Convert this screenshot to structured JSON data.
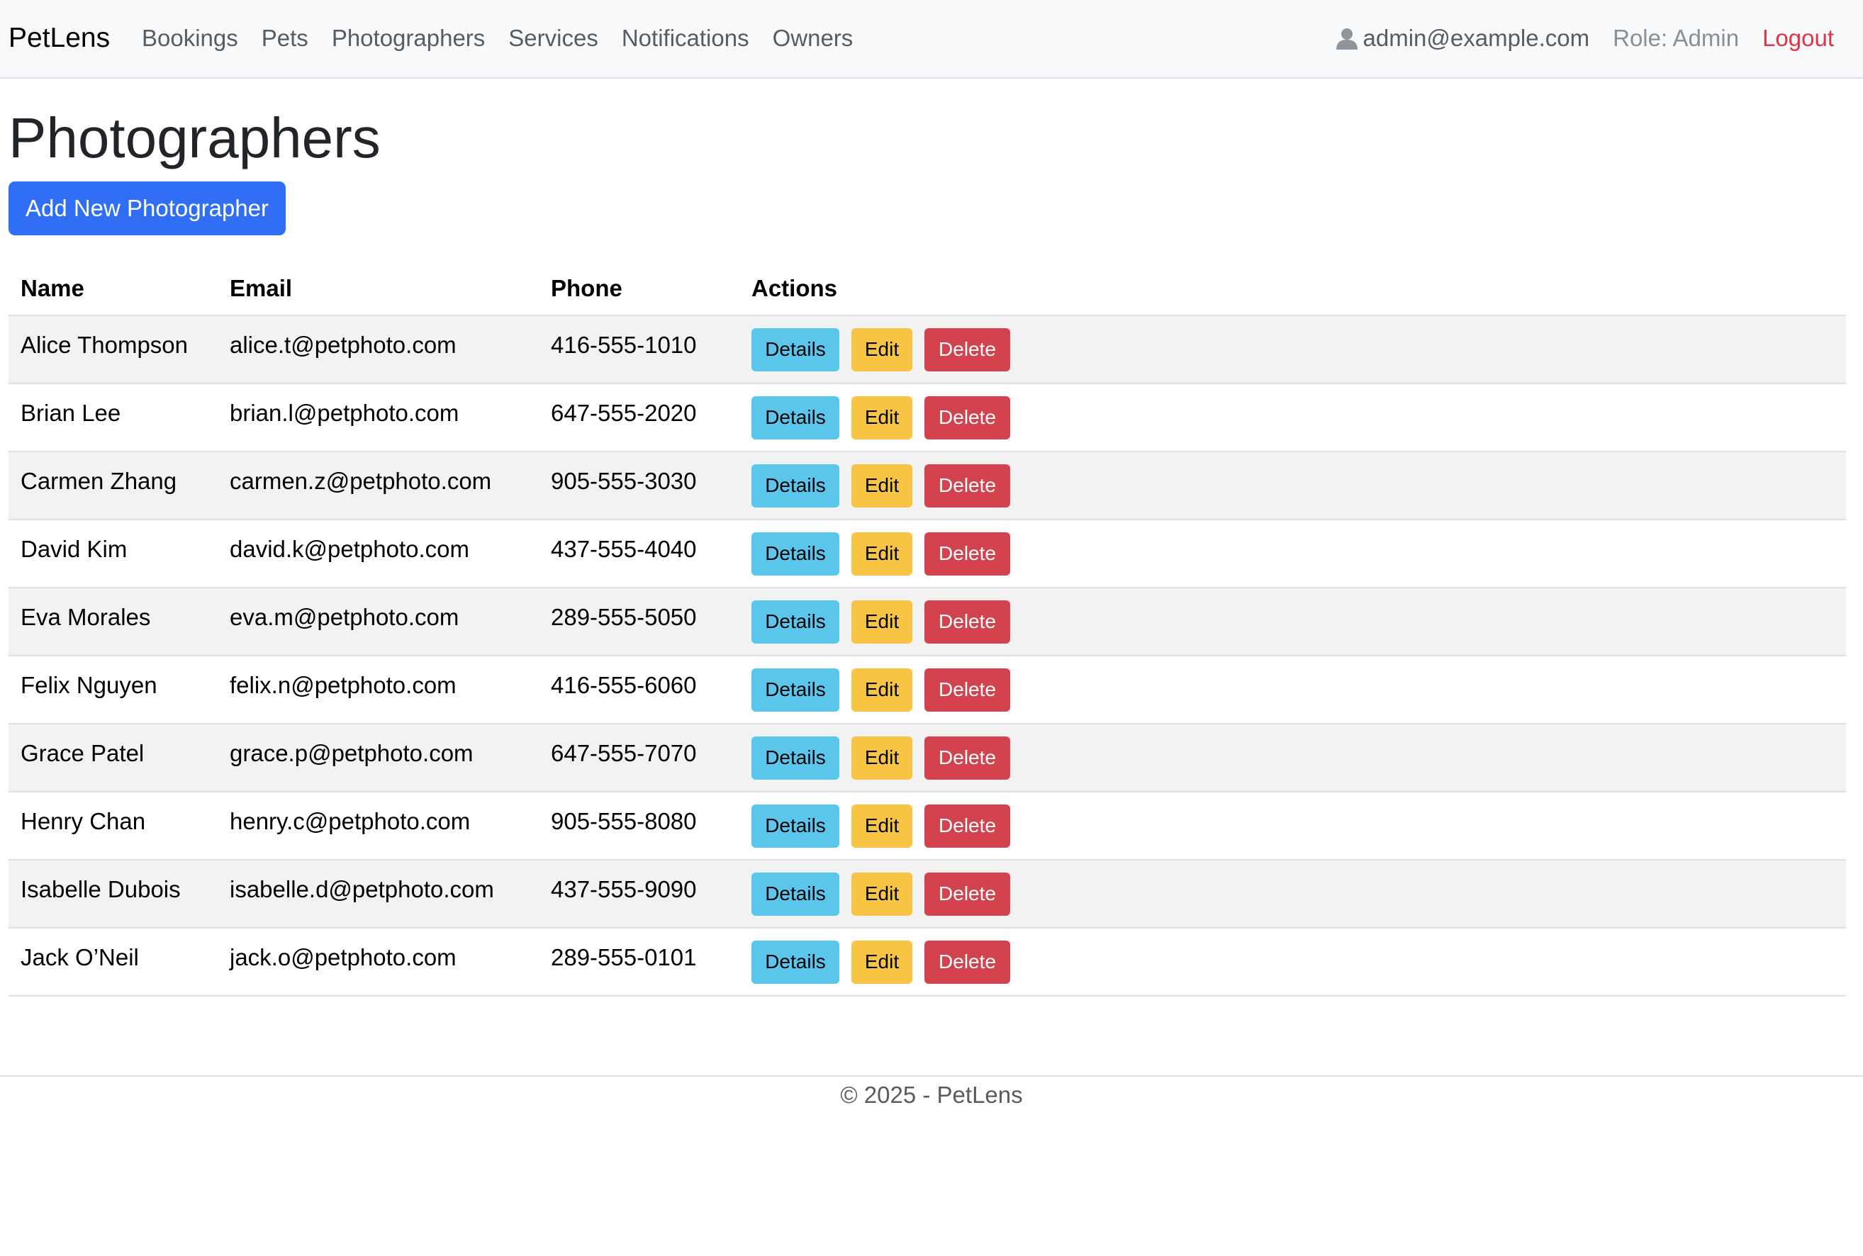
{
  "nav": {
    "brand": "PetLens",
    "links": [
      "Bookings",
      "Pets",
      "Photographers",
      "Services",
      "Notifications",
      "Owners"
    ],
    "user_email": "admin@example.com",
    "role": "Role: Admin",
    "logout": "Logout"
  },
  "page": {
    "title": "Photographers",
    "add_button": "Add New Photographer"
  },
  "table": {
    "headers": [
      "Name",
      "Email",
      "Phone",
      "Actions"
    ],
    "rows": [
      {
        "name": "Alice Thompson",
        "email": "alice.t@petphoto.com",
        "phone": "416-555-1010"
      },
      {
        "name": "Brian Lee",
        "email": "brian.l@petphoto.com",
        "phone": "647-555-2020"
      },
      {
        "name": "Carmen Zhang",
        "email": "carmen.z@petphoto.com",
        "phone": "905-555-3030"
      },
      {
        "name": "David Kim",
        "email": "david.k@petphoto.com",
        "phone": "437-555-4040"
      },
      {
        "name": "Eva Morales",
        "email": "eva.m@petphoto.com",
        "phone": "289-555-5050"
      },
      {
        "name": "Felix Nguyen",
        "email": "felix.n@petphoto.com",
        "phone": "416-555-6060"
      },
      {
        "name": "Grace Patel",
        "email": "grace.p@petphoto.com",
        "phone": "647-555-7070"
      },
      {
        "name": "Henry Chan",
        "email": "henry.c@petphoto.com",
        "phone": "905-555-8080"
      },
      {
        "name": "Isabelle Dubois",
        "email": "isabelle.d@petphoto.com",
        "phone": "437-555-9090"
      },
      {
        "name": "Jack O’Neil",
        "email": "jack.o@petphoto.com",
        "phone": "289-555-0101"
      }
    ],
    "action_labels": {
      "details": "Details",
      "edit": "Edit",
      "delete": "Delete"
    }
  },
  "footer": {
    "text": "© 2025 - PetLens"
  },
  "icons": {
    "user": "user-icon"
  },
  "colors": {
    "primary": "#2f6ef5",
    "info": "#5bc6ec",
    "warning": "#f8c443",
    "danger": "#d2434d",
    "logout": "#dc3545"
  }
}
